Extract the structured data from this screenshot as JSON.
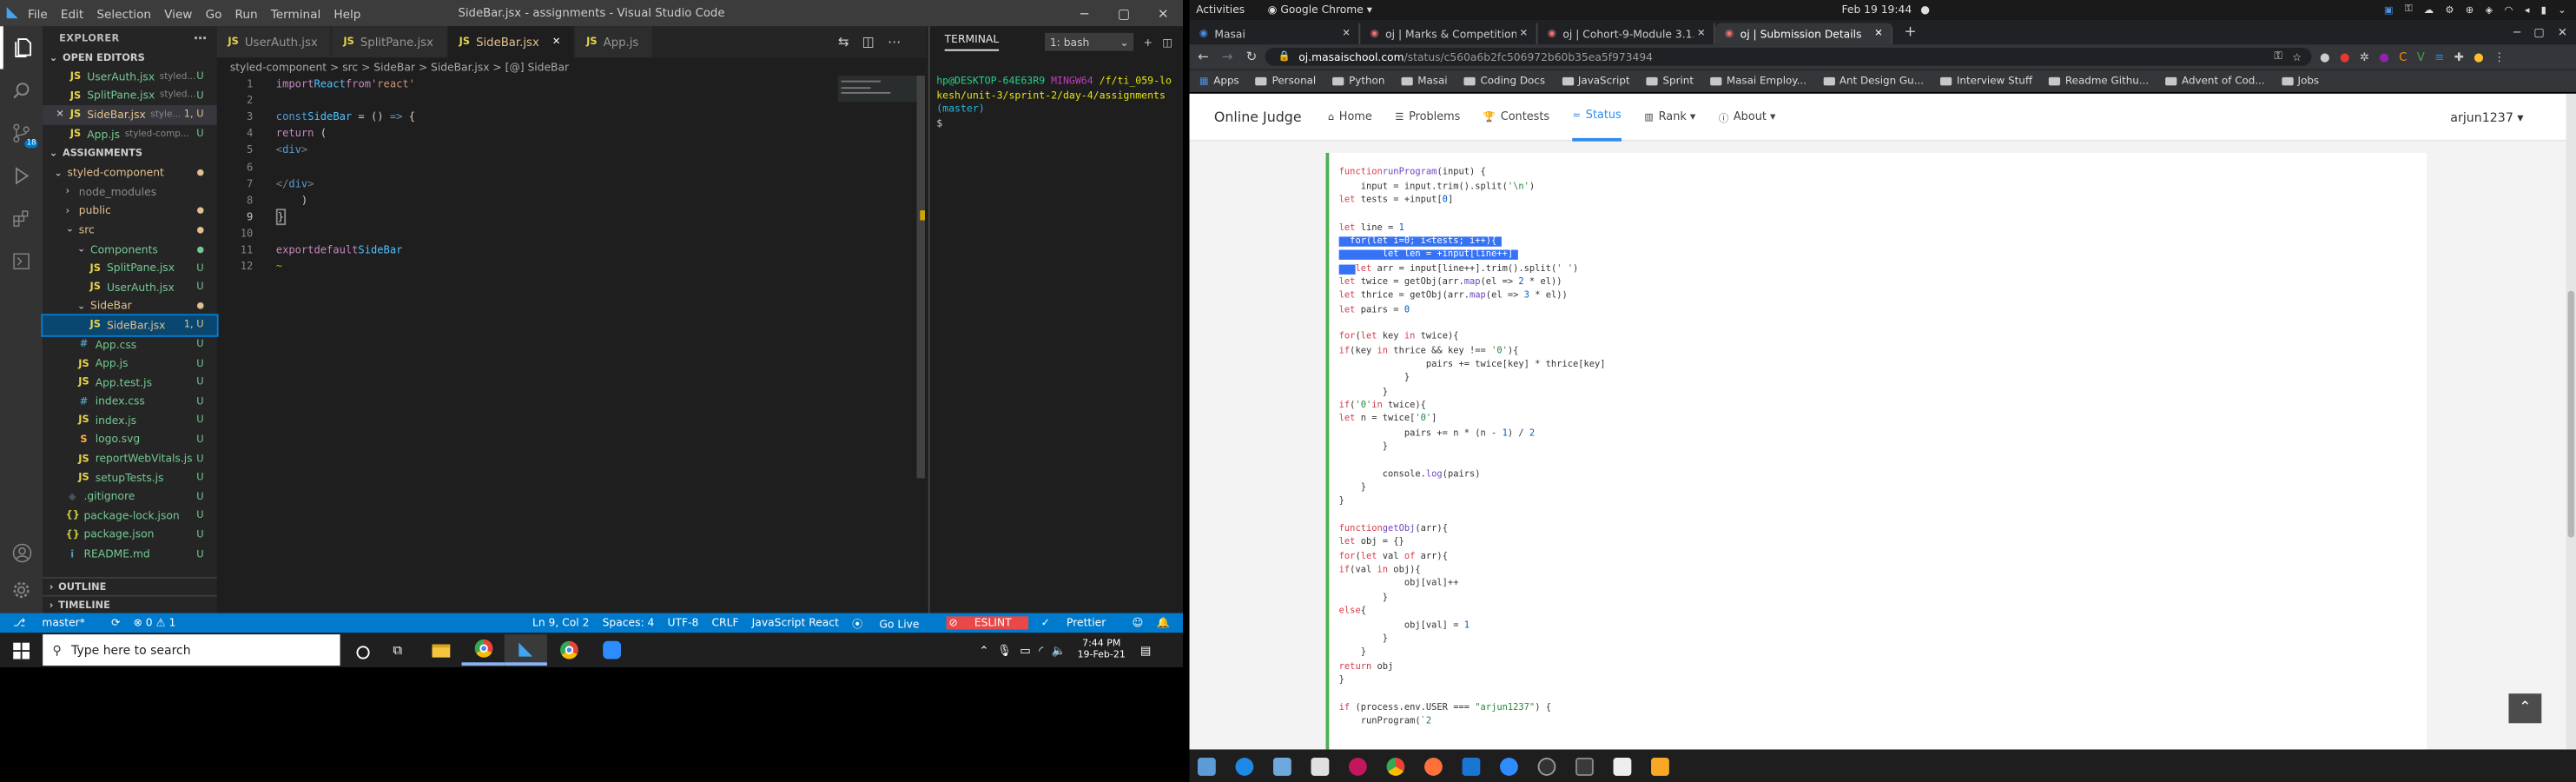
{
  "vscode": {
    "menu": [
      "File",
      "Edit",
      "Selection",
      "View",
      "Go",
      "Run",
      "Terminal",
      "Help"
    ],
    "title": "SideBar.jsx - assignments - Visual Studio Code",
    "explorer_header": "EXPLORER",
    "open_editors_label": "OPEN EDITORS",
    "open_editors": [
      {
        "name": "UserAuth.jsx",
        "hint": "styled...",
        "status": "U"
      },
      {
        "name": "SplitPane.jsx",
        "hint": "styled...",
        "status": "U"
      },
      {
        "name": "SideBar.jsx",
        "hint": "style...",
        "status": "1, U"
      },
      {
        "name": "App.js",
        "hint": "styled-comp...",
        "status": "U"
      }
    ],
    "folder_label": "ASSIGNMENTS",
    "tree": [
      {
        "name": "styled-component",
        "type": "folder",
        "indent": 1,
        "open": true,
        "color": "#e2c08d",
        "dot": true
      },
      {
        "name": "node_modules",
        "type": "folder",
        "indent": 2,
        "open": false,
        "color": "#8c8c8c"
      },
      {
        "name": "public",
        "type": "folder",
        "indent": 2,
        "open": false,
        "color": "#e2c08d",
        "dot": true
      },
      {
        "name": "src",
        "type": "folder",
        "indent": 2,
        "open": true,
        "color": "#e2c08d",
        "dot": true
      },
      {
        "name": "Components",
        "type": "folder",
        "indent": 3,
        "open": true,
        "color": "#73c991",
        "dot": true
      },
      {
        "name": "SplitPane.jsx",
        "type": "file",
        "icon": "JS",
        "indent": 4,
        "color": "#73c991",
        "status": "U"
      },
      {
        "name": "UserAuth.jsx",
        "type": "file",
        "icon": "JS",
        "indent": 4,
        "color": "#73c991",
        "status": "U"
      },
      {
        "name": "SideBar",
        "type": "folder",
        "indent": 3,
        "open": true,
        "color": "#e2c08d",
        "dot": true
      },
      {
        "name": "SideBar.jsx",
        "type": "file",
        "icon": "JS",
        "indent": 4,
        "color": "#e2c08d",
        "status": "1, U",
        "selected": true
      },
      {
        "name": "App.css",
        "type": "file",
        "icon": "#",
        "indent": 3,
        "color": "#73c991",
        "status": "U"
      },
      {
        "name": "App.js",
        "type": "file",
        "icon": "JS",
        "indent": 3,
        "color": "#73c991",
        "status": "U"
      },
      {
        "name": "App.test.js",
        "type": "file",
        "icon": "JS",
        "indent": 3,
        "color": "#73c991",
        "status": "U"
      },
      {
        "name": "index.css",
        "type": "file",
        "icon": "#",
        "indent": 3,
        "color": "#73c991",
        "status": "U"
      },
      {
        "name": "index.js",
        "type": "file",
        "icon": "JS",
        "indent": 3,
        "color": "#73c991",
        "status": "U"
      },
      {
        "name": "logo.svg",
        "type": "file",
        "icon": "S",
        "indent": 3,
        "color": "#73c991",
        "status": "U"
      },
      {
        "name": "reportWebVitals.js",
        "type": "file",
        "icon": "JS",
        "indent": 3,
        "color": "#73c991",
        "status": "U"
      },
      {
        "name": "setupTests.js",
        "type": "file",
        "icon": "JS",
        "indent": 3,
        "color": "#73c991",
        "status": "U"
      },
      {
        "name": ".gitignore",
        "type": "file",
        "icon": "◆",
        "indent": 2,
        "color": "#73c991",
        "status": "U"
      },
      {
        "name": "package-lock.json",
        "type": "file",
        "icon": "{}",
        "indent": 2,
        "color": "#73c991",
        "status": "U"
      },
      {
        "name": "package.json",
        "type": "file",
        "icon": "{}",
        "indent": 2,
        "color": "#73c991",
        "status": "U"
      },
      {
        "name": "README.md",
        "type": "file",
        "icon": "i",
        "indent": 2,
        "color": "#73c991",
        "status": "U"
      }
    ],
    "outline_label": "OUTLINE",
    "timeline_label": "TIMELINE",
    "tabs": [
      {
        "name": "UserAuth.jsx",
        "active": false
      },
      {
        "name": "SplitPane.jsx",
        "active": false
      },
      {
        "name": "SideBar.jsx",
        "active": true
      },
      {
        "name": "App.js",
        "active": false
      }
    ],
    "breadcrumb": "styled-component > src > SideBar > SideBar.jsx > [@] SideBar",
    "code_numbers": [
      "1",
      "2",
      "3",
      "4",
      "5",
      "6",
      "7",
      "8",
      "9",
      "10",
      "11",
      "12"
    ],
    "terminal_label": "TERMINAL",
    "terminal_select": "1: bash",
    "terminal_prompt": "hp@DESKTOP-64E63R9",
    "terminal_env": "MINGW64",
    "terminal_path": "/f/ti_059-lokesh/unit-3/sprint-2/day-4/assignments",
    "terminal_branch": "(master)",
    "terminal_dollar": "$",
    "status": {
      "branch": "master*",
      "sync": "⟳",
      "problems": "⊗ 0 ⚠ 1",
      "position": "Ln 9, Col 2",
      "spaces": "Spaces: 4",
      "encoding": "UTF-8",
      "eol": "CRLF",
      "language": "JavaScript React",
      "golive": "Go Live",
      "eslint": "ESLINT",
      "prettier": "Prettier"
    }
  },
  "windows_taskbar": {
    "search_placeholder": "Type here to search",
    "time": "7:44 PM",
    "date": "19-Feb-21"
  },
  "ubuntu": {
    "activities": "Activities",
    "app": "Google Chrome ▾",
    "clock": "Feb 19  19:44"
  },
  "chrome": {
    "tabs": [
      {
        "title": "Masai",
        "active": false
      },
      {
        "title": "oj | Marks & Competition",
        "active": false
      },
      {
        "title": "oj | Cohort-9-Module 3.1...",
        "active": false
      },
      {
        "title": "oj | Submission Details",
        "active": true
      }
    ],
    "url_host": "oj.masaischool.com",
    "url_path": "/status/c560a6b2fc506972b60b35ea5f973494",
    "bookmarks": [
      "Apps",
      "Personal",
      "Python",
      "Masai",
      "Coding Docs",
      "JavaScript",
      "Sprint",
      "Masai Employ...",
      "Ant Design Gu...",
      "Interview Stuff",
      "Readme Githu...",
      "Advent of Cod...",
      "Jobs"
    ]
  },
  "oj": {
    "brand": "Online Judge",
    "nav": [
      {
        "label": "Home",
        "icon": "⌂"
      },
      {
        "label": "Problems",
        "icon": "☰"
      },
      {
        "label": "Contests",
        "icon": "🏆"
      },
      {
        "label": "Status",
        "icon": "≈",
        "active": true
      },
      {
        "label": "Rank ▾",
        "icon": "▥"
      },
      {
        "label": "About ▾",
        "icon": "ⓘ"
      }
    ],
    "user": "arjun1237 ▾"
  }
}
